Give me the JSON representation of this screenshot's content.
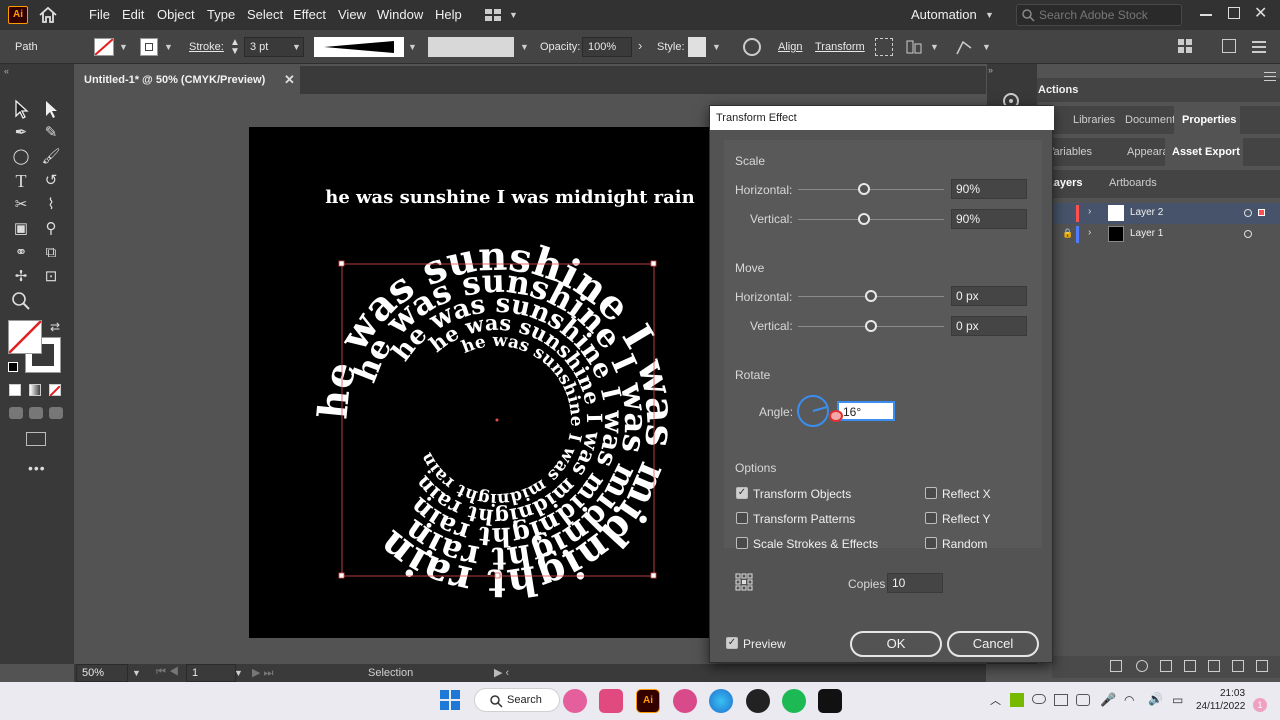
{
  "menubar": {
    "app_logo": "Ai",
    "items": [
      "File",
      "Edit",
      "Object",
      "Type",
      "Select",
      "Effect",
      "View",
      "Window",
      "Help"
    ],
    "workspace": "Automation",
    "search_placeholder": "Search Adobe Stock"
  },
  "controlbar": {
    "selection_type": "Path",
    "stroke_label": "Stroke:",
    "stroke_value": "3 pt",
    "opacity_label": "Opacity:",
    "opacity_value": "100%",
    "style_label": "Style:",
    "align_label": "Align",
    "transform_label": "Transform"
  },
  "document": {
    "tab_title": "Untitled-1* @ 50% (CMYK/Preview)",
    "zoom": "50%",
    "artboard_number": "1",
    "status": "Selection"
  },
  "artwork": {
    "headline": "he was sunshine I was midnight rain",
    "ring_text": "he was sunshine I was midnight rain"
  },
  "panels": {
    "actions_title": "Actions",
    "tabs_row1": [
      "Libraries",
      "Document",
      "Properties"
    ],
    "tabs_row2": [
      "Variables",
      "Appearance",
      "Asset Export"
    ],
    "tabs_row3": [
      "Layers",
      "Artboards"
    ],
    "layers": [
      {
        "name": "Layer 2",
        "color": "#ff4f4f"
      },
      {
        "name": "Layer 1",
        "color": "#4f7cff"
      }
    ]
  },
  "dialog": {
    "title": "Transform Effect",
    "scale_section": "Scale",
    "scale_h_label": "Horizontal:",
    "scale_h_value": "90%",
    "scale_v_label": "Vertical:",
    "scale_v_value": "90%",
    "move_section": "Move",
    "move_h_label": "Horizontal:",
    "move_h_value": "0 px",
    "move_v_label": "Vertical:",
    "move_v_value": "0 px",
    "rotate_section": "Rotate",
    "angle_label": "Angle:",
    "angle_value": "16°",
    "options_section": "Options",
    "opt_transform_objects": "Transform Objects",
    "opt_transform_patterns": "Transform Patterns",
    "opt_scale_strokes": "Scale Strokes & Effects",
    "opt_reflect_x": "Reflect X",
    "opt_reflect_y": "Reflect Y",
    "opt_random": "Random",
    "copies_label": "Copies",
    "copies_value": "10",
    "preview_label": "Preview",
    "ok_label": "OK",
    "cancel_label": "Cancel",
    "checked": {
      "transform_objects": true,
      "transform_patterns": false,
      "scale_strokes": false,
      "reflect_x": false,
      "reflect_y": false,
      "random": false,
      "preview": true
    }
  },
  "taskbar": {
    "search_label": "Search",
    "time": "21:03",
    "date": "24/11/2022"
  }
}
